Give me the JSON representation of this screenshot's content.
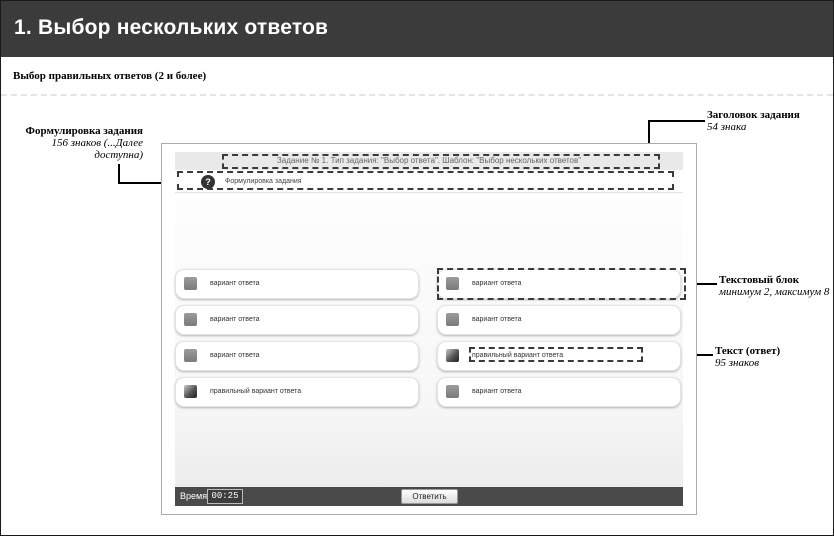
{
  "header": {
    "title": "1. Выбор нескольких ответов"
  },
  "subtitle": "Выбор правильных ответов (2 и более)",
  "annotations": {
    "formulation": {
      "title": "Формулировка задания",
      "desc_line1": "156 знаков (...Далее",
      "desc_line2": "доступна)"
    },
    "task_title": {
      "title": "Заголовок задания",
      "desc": "54 знака"
    },
    "text_block": {
      "title": "Текстовый блок",
      "desc": "минимум 2, максимум 8"
    },
    "answer_text": {
      "title": "Текст (ответ)",
      "desc": "95 знаков"
    }
  },
  "app": {
    "task_header": "Задание № 1. Тип задания: \"Выбор ответа\". Шаблон: \"Выбор нескольких ответов\"",
    "formulation_icon": "question-icon",
    "formulation_text": "Формулировка задания",
    "options_left": [
      {
        "label": "вариант ответа",
        "icon": "checkbox-icon"
      },
      {
        "label": "вариант ответа",
        "icon": "checkbox-icon"
      },
      {
        "label": "вариант ответа",
        "icon": "checkbox-icon"
      },
      {
        "label": "правильный вариант ответа",
        "icon": "checkbox-checked-icon"
      }
    ],
    "options_right": [
      {
        "label": "вариант ответа",
        "icon": "checkbox-icon"
      },
      {
        "label": "вариант ответа",
        "icon": "checkbox-icon"
      },
      {
        "label": "правильный вариант ответа",
        "icon": "checkbox-checked-icon"
      },
      {
        "label": "вариант ответа",
        "icon": "checkbox-icon"
      }
    ],
    "footer": {
      "time_label": "Время",
      "time_value": "00:25",
      "answer_button": "Ответить"
    }
  }
}
